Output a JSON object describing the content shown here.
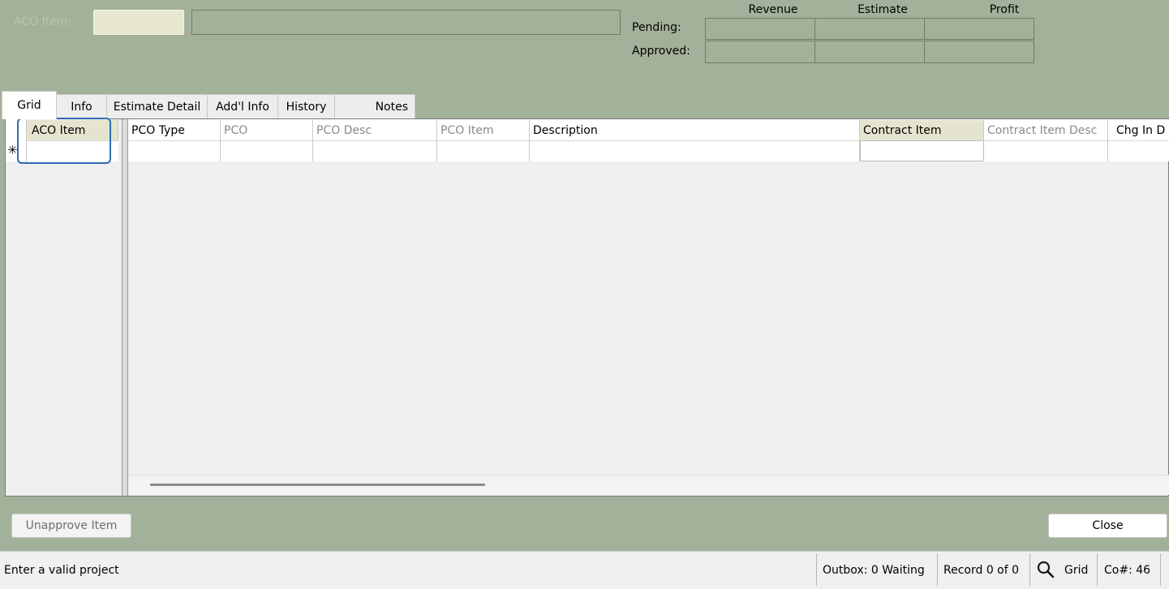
{
  "header": {
    "aco_item_label": "ACO Item:",
    "aco_item_value": "",
    "aco_desc_value": "",
    "financials": {
      "columns": [
        "Revenue",
        "Estimate",
        "Profit"
      ],
      "rows": [
        {
          "label": "Pending:",
          "values": [
            "",
            "",
            ""
          ]
        },
        {
          "label": "Approved:",
          "values": [
            "",
            "",
            ""
          ]
        }
      ]
    }
  },
  "tabs": [
    {
      "label": "Grid",
      "active": true
    },
    {
      "label": "Info"
    },
    {
      "label": "Estimate Detail"
    },
    {
      "label": "Add'l Info"
    },
    {
      "label": "History"
    },
    {
      "label": "Notes"
    }
  ],
  "left_grid": {
    "new_row_marker": "✳",
    "column": "ACO Item"
  },
  "main_grid": {
    "columns": [
      "PCO Type",
      "PCO",
      "PCO Desc",
      "PCO Item",
      "Description",
      "Contract Item",
      "Contract Item Desc",
      "Chg In D"
    ]
  },
  "buttons": {
    "unapprove": "Unapprove Item",
    "close": "Close"
  },
  "status": {
    "message": "Enter a valid project",
    "outbox": "Outbox: 0 Waiting",
    "record": "Record 0 of 0",
    "view": "Grid",
    "company": "Co#: 46"
  },
  "colors": {
    "background": "#a4b19a",
    "required_field": "#e5e4cf",
    "focus_ring": "#2f6db5"
  },
  "icons": {
    "search": "magnifier-icon"
  }
}
